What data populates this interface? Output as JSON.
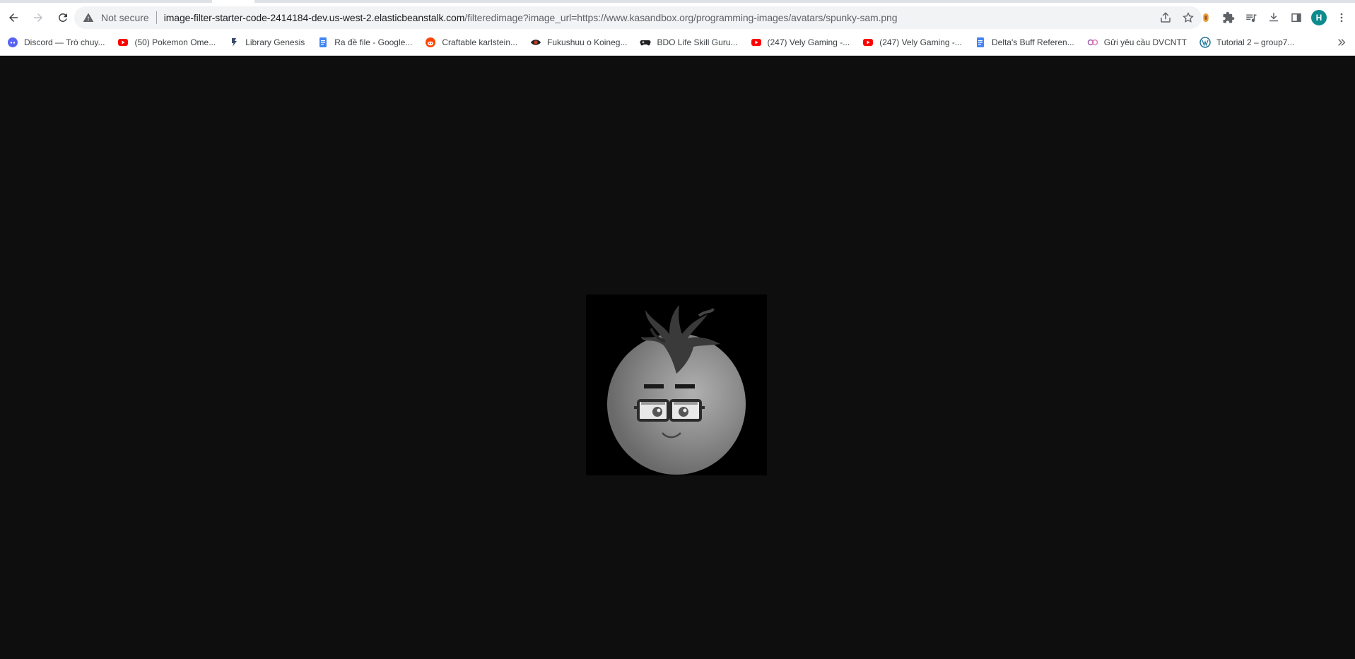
{
  "browser": {
    "nav": {
      "back_icon": "arrow-left-icon",
      "forward_icon": "arrow-right-icon",
      "reload_icon": "reload-icon"
    },
    "omnibox": {
      "security_label": "Not secure",
      "url_host": "image-filter-starter-code-2414184-dev.us-west-2.elasticbeanstalk.com",
      "url_path": "/filteredimage?image_url=https://www.kasandbox.org/programming-images/avatars/spunky-sam.png"
    },
    "profile_initial": "H",
    "bookmarks": [
      {
        "label": "Discord — Trò chuy...",
        "icon": "discord-icon",
        "color": "#5865f2"
      },
      {
        "label": "(50) Pokemon Ome...",
        "icon": "youtube-icon",
        "color": "#ff0000"
      },
      {
        "label": "Library Genesis",
        "icon": "libgen-icon",
        "color": "#3b4a6b"
      },
      {
        "label": "Ra đề file - Google...",
        "icon": "google-docs-icon",
        "color": "#4285f4"
      },
      {
        "label": "Craftable karlstein...",
        "icon": "reddit-icon",
        "color": "#ff4500"
      },
      {
        "label": "Fukushuu o Koineg...",
        "icon": "eye-icon",
        "color": "#c0392b"
      },
      {
        "label": "BDO Life Skill Guru...",
        "icon": "gamepad-icon",
        "color": "#202124"
      },
      {
        "label": "(247) Vely Gaming -...",
        "icon": "youtube-icon",
        "color": "#ff0000"
      },
      {
        "label": "(247) Vely Gaming -...",
        "icon": "youtube-icon",
        "color": "#ff0000"
      },
      {
        "label": "Delta's Buff Referen...",
        "icon": "google-docs-icon",
        "color": "#4285f4"
      },
      {
        "label": "Gửi yêu cầu DVCNTT",
        "icon": "dvc-icon",
        "color": "#9b59b6"
      },
      {
        "label": "Tutorial 2 – group7...",
        "icon": "wordpress-icon",
        "color": "#21759b"
      }
    ]
  },
  "content": {
    "image_subject": "grayscale-tomato-avatar-with-glasses"
  }
}
